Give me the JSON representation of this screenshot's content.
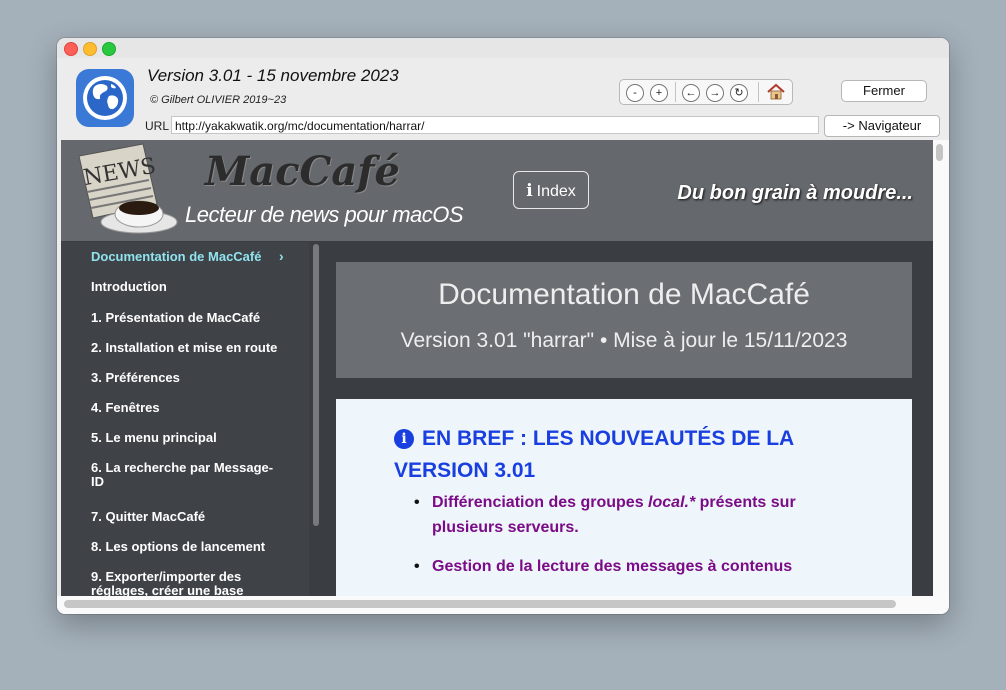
{
  "window": {
    "version_line": "Version 3.01 - 15 novembre 2023",
    "copyright": "© Gilbert OLIVIER 2019~23",
    "close_label": "Fermer",
    "url_label": "URL",
    "url_value": "http://yakakwatik.org/mc/documentation/harrar/",
    "open_in_browser_label": "-> Navigateur",
    "nav_buttons": [
      "-",
      "+",
      "←",
      "→",
      "↻"
    ]
  },
  "banner": {
    "brand": "MacCafé",
    "subtitle": "Lecteur de news pour macOS",
    "newspaper_text": "NEWS",
    "index_label": "Index",
    "tagline": "Du bon grain à moudre..."
  },
  "sidebar": {
    "active": "Documentation de MacCafé",
    "items": [
      "Introduction",
      "1. Présentation de MacCafé",
      "2. Installation et mise en route",
      "3. Préférences",
      "4. Fenêtres",
      "5. Le menu principal",
      "6. La recherche par Message-ID",
      "7. Quitter MacCafé",
      "8. Les options de lancement",
      "9. Exporter/importer des réglages, créer une base"
    ]
  },
  "doc": {
    "title": "Documentation de MacCafé",
    "subtitle": "Version 3.01 \"harrar\" • Mise à jour le 15/11/2023",
    "brief_heading": "EN BREF : LES NOUVEAUTÉS DE LA VERSION 3.01",
    "bullet1_a": "Différenciation des groupes ",
    "bullet1_em": "local.*",
    "bullet1_b": " présents sur plusieurs serveurs.",
    "bullet2": "Gestion de la lecture des messages à contenus"
  },
  "colors": {
    "link_active": "#8fe3ee",
    "heading_blue": "#1a3fe0",
    "bullet_purple": "#7b0b86"
  }
}
